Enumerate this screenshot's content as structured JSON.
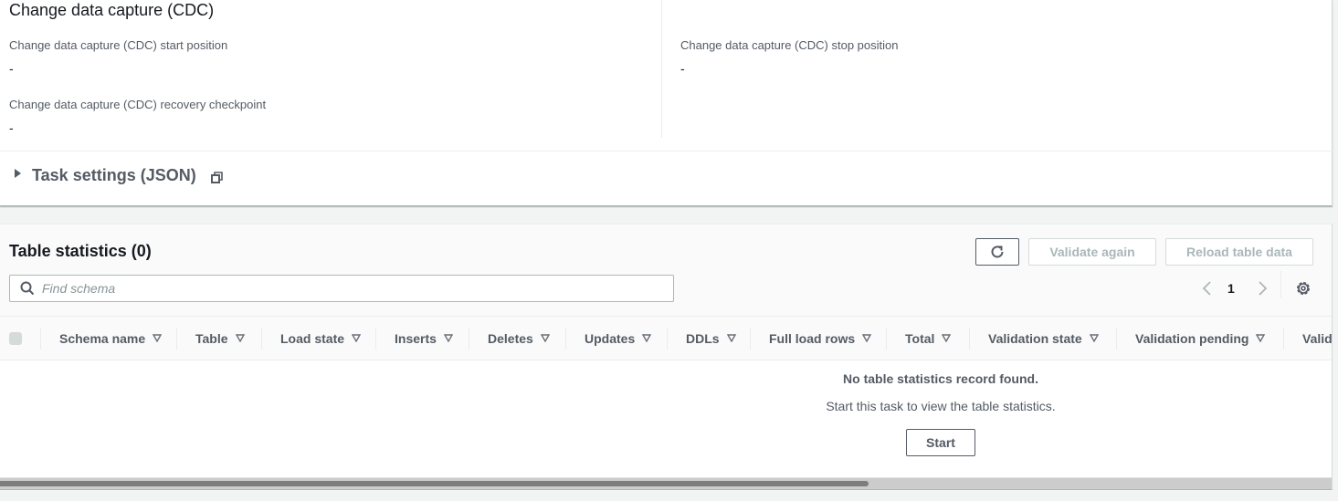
{
  "cdc": {
    "title": "Change data capture (CDC)",
    "start_position": {
      "label": "Change data capture (CDC) start position",
      "value": "-"
    },
    "stop_position": {
      "label": "Change data capture (CDC) stop position",
      "value": "-"
    },
    "recovery_checkpoint": {
      "label": "Change data capture (CDC) recovery checkpoint",
      "value": "-"
    }
  },
  "task_settings": {
    "title": "Task settings (JSON)",
    "expanded": false
  },
  "table_statistics": {
    "title": "Table statistics (0)",
    "buttons": {
      "refresh_icon": "refresh-icon",
      "validate_again": "Validate again",
      "reload_table_data": "Reload table data"
    },
    "search": {
      "placeholder": "Find schema",
      "value": ""
    },
    "pagination": {
      "current_page": "1"
    },
    "columns": [
      "Schema name",
      "Table",
      "Load state",
      "Inserts",
      "Deletes",
      "Updates",
      "DDLs",
      "Full load rows",
      "Total",
      "Validation state",
      "Validation pending",
      "Valid"
    ],
    "empty": {
      "title": "No table statistics record found.",
      "subtitle": "Start this task to view the table statistics.",
      "action": "Start"
    },
    "horizontal_scroll_fraction": 0.65
  },
  "colors": {
    "text_primary": "#16191f",
    "text_secondary": "#545b64",
    "disabled": "#aab7b8",
    "border": "#eaeded",
    "page_bg": "#f2f3f3"
  }
}
